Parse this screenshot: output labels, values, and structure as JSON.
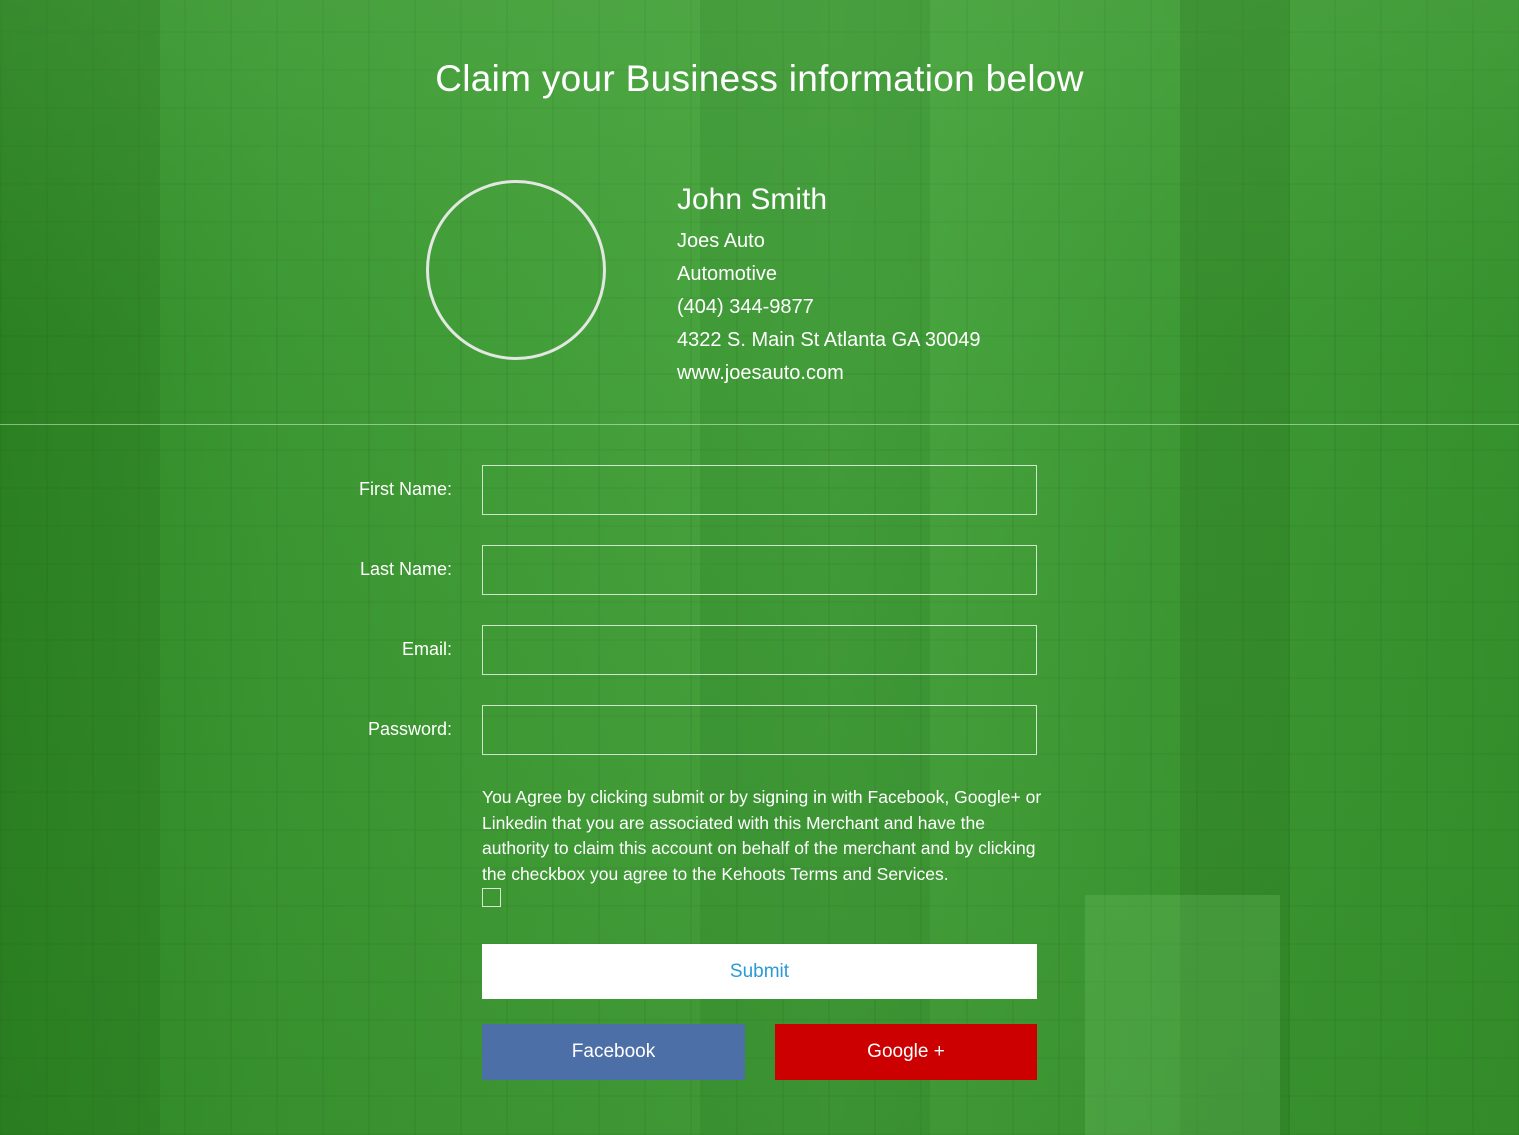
{
  "page": {
    "headline": "Claim your Business information below"
  },
  "profile": {
    "name": "John Smith",
    "business": "Joes Auto",
    "category": "Automotive",
    "phone": "(404) 344-9877",
    "address": "4322 S. Main St Atlanta GA 30049",
    "website": "www.joesauto.com"
  },
  "form": {
    "first_name_label": "First Name:",
    "first_name_value": "",
    "last_name_label": "Last Name:",
    "last_name_value": "",
    "email_label": "Email:",
    "email_value": "",
    "password_label": "Password:",
    "password_value": "",
    "agreement_text": "You Agree by clicking submit or by signing in with Facebook, Google+ or Linkedin that you are associated with this Merchant and have the authority to claim this account on behalf of the merchant and by clicking the checkbox you agree to the Kehoots Terms and Services.",
    "agreement_checked": false
  },
  "buttons": {
    "submit": "Submit",
    "facebook": "Facebook",
    "google": "Google +"
  },
  "colors": {
    "background_tint": "#3f9a35",
    "submit_bg": "#ffffff",
    "submit_text": "#2a9ad6",
    "facebook": "#4d6fa7",
    "google": "#cc0000"
  }
}
